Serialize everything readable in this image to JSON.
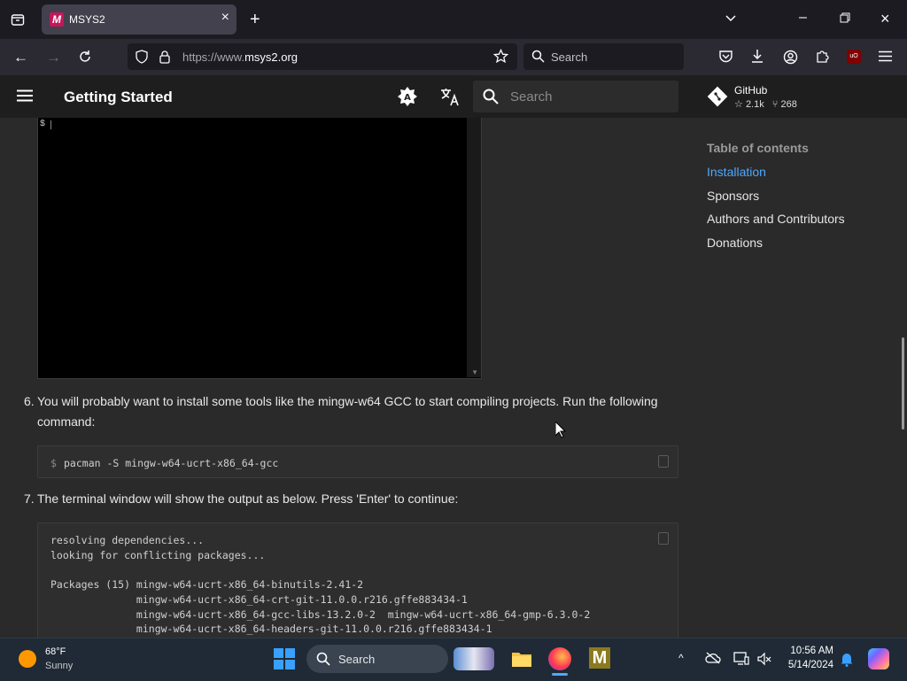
{
  "browser": {
    "tab_title": "MSYS2",
    "tab_favicon_letter": "M",
    "url_prefix": "https://www.",
    "url_domain": "msys2.org",
    "search_placeholder": "Search"
  },
  "site": {
    "title": "Getting Started",
    "search_placeholder": "Search",
    "github_label": "GitHub",
    "stars": "2.1k",
    "forks": "268"
  },
  "terminal": {
    "prompt": "$"
  },
  "steps": [
    {
      "number": "6.",
      "text_line1": "You will probably want to install some tools like the mingw-w64 GCC to start compiling projects. Run the following",
      "text_line2": "command:",
      "code": "$ pacman -S mingw-w64-ucrt-x86_64-gcc"
    },
    {
      "number": "7.",
      "text_line1": "The terminal window will show the output as below. Press 'Enter' to continue:",
      "code_lines": [
        "resolving dependencies...",
        "looking for conflicting packages...",
        "",
        "Packages (15) mingw-w64-ucrt-x86_64-binutils-2.41-2",
        "              mingw-w64-ucrt-x86_64-crt-git-11.0.0.r216.gffe883434-1",
        "              mingw-w64-ucrt-x86_64-gcc-libs-13.2.0-2  mingw-w64-ucrt-x86_64-gmp-6.3.0-2",
        "              mingw-w64-ucrt-x86_64-headers-git-11.0.0.r216.gffe883434-1"
      ]
    }
  ],
  "toc": {
    "heading": "Table of contents",
    "items": [
      "Installation",
      "Sponsors",
      "Authors and Contributors",
      "Donations"
    ]
  },
  "taskbar": {
    "weather_temp": "68°F",
    "weather_desc": "Sunny",
    "search_placeholder": "Search",
    "time": "10:56 AM",
    "date": "5/14/2024"
  },
  "colors": {
    "accent": "#4ea8ff",
    "page_bg": "#2a2a2a",
    "header_bg": "#1e1e1e"
  }
}
